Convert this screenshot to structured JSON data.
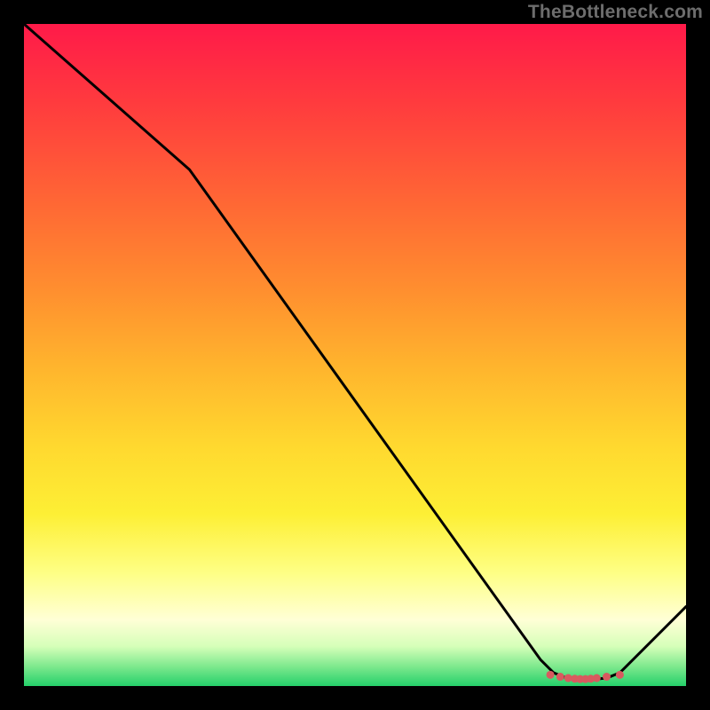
{
  "watermark": "TheBottleneck.com",
  "chart_data": {
    "type": "line",
    "title": "",
    "xlabel": "",
    "ylabel": "",
    "xlim": [
      0,
      100
    ],
    "ylim": [
      0,
      100
    ],
    "grid": false,
    "series": [
      {
        "name": "curve",
        "x": [
          0,
          25,
          78,
          80,
          82,
          84,
          86,
          88,
          90,
          100
        ],
        "y": [
          100,
          78,
          4,
          2,
          1.2,
          1,
          1,
          1.2,
          2,
          12
        ],
        "color": "#000000",
        "width": 3
      }
    ],
    "markers": {
      "name": "flat-bottom-markers",
      "x": [
        79.5,
        81,
        82.2,
        83.2,
        84.0,
        84.8,
        85.6,
        86.5,
        88,
        90
      ],
      "y": [
        1.7,
        1.4,
        1.2,
        1.1,
        1.05,
        1.05,
        1.1,
        1.2,
        1.4,
        1.7
      ],
      "color": "#d85a5f",
      "size": 9
    }
  }
}
